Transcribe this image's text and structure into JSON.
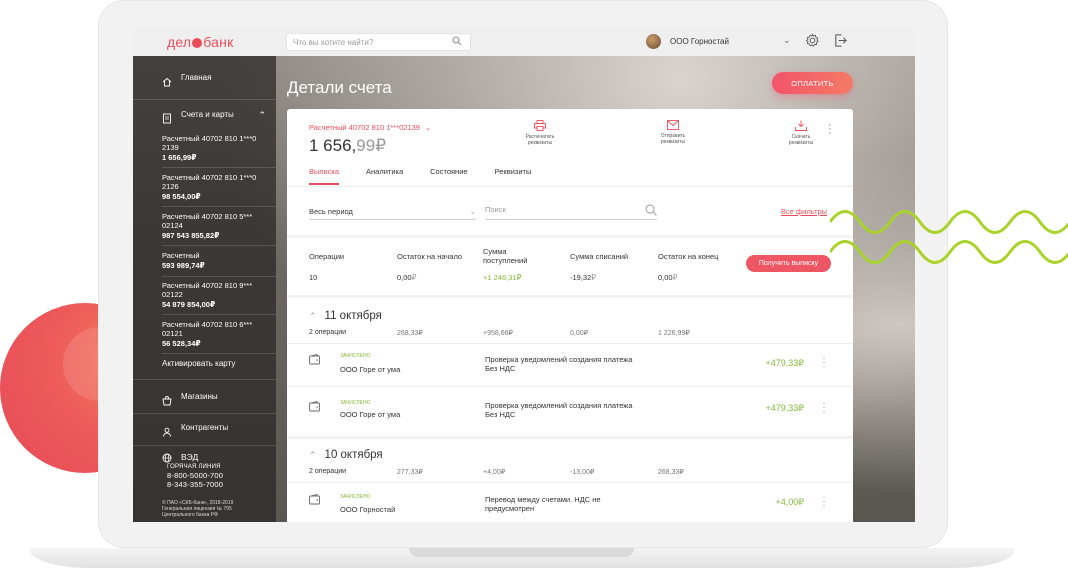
{
  "topbar": {
    "logo_left": "дел",
    "logo_right": "банк",
    "search_placeholder": "Что вы хотите найти?",
    "company": "ООО Горностай"
  },
  "sidebar": {
    "home": "Главная",
    "accounts": "Счета и карты",
    "account_list": [
      {
        "name": "Расчетный 40702 810 1***0 2139",
        "balance": "1 656,99₽"
      },
      {
        "name": "Расчетный 40702 810 1***0 2126",
        "balance": "98 554,00₽"
      },
      {
        "name": "Расчетный 40702 810 5*** 02124",
        "balance": "987 543 855,82₽"
      },
      {
        "name": "Расчетный",
        "balance": "593 989,74₽"
      },
      {
        "name": "Расчетный 40702 810 9*** 02122",
        "balance": "54 879 854,00₽"
      },
      {
        "name": "Расчетный 40702 810 6*** 02121",
        "balance": "56 528,34₽"
      }
    ],
    "activate_card": "Активировать карту",
    "shops": "Магазины",
    "contractors": "Контрагенты",
    "ved": "ВЭД",
    "hotline_label": "ГОРЯЧАЯ ЛИНИЯ",
    "phone1": "8-800-5000-700",
    "phone2": "8-343-355-7000",
    "copyright": "© ПАО «СКБ-банк», 2018-2019",
    "license": "Генеральная лицензия № 705",
    "cb": "Центрального банка РФ"
  },
  "main": {
    "title": "Детали счета",
    "pay_button": "ОПЛАТИТЬ",
    "account_number": "Расчетный 40702 810 1***02139",
    "balance_int": "1 656,",
    "balance_frac": "99",
    "currency": "₽",
    "actions": {
      "print_1": "Распечатать",
      "print_2": "реквизиты",
      "send_1": "Отправить",
      "send_2": "реквизиты",
      "download_1": "Скачать",
      "download_2": "реквизиты"
    },
    "tabs": [
      "Выписка",
      "Аналитика",
      "Состояние",
      "Реквизиты"
    ],
    "period": "Весь период",
    "search_placeholder": "Поиск",
    "all_filters": "Все фильтры",
    "summary_headers": {
      "operations": "Операции",
      "start_balance": "Остаток на начало",
      "income_1": "Сумма",
      "income_2": "поступлений",
      "spend": "Сумма списаний",
      "end_balance": "Остаток на конец"
    },
    "summary_values": {
      "operations": "10",
      "start_int": "0,00",
      "income_int": "+1 246,31",
      "spend_int": "-19,32",
      "end_int": "0,00",
      "rub": "₽"
    },
    "get_statement": "Получить выписку",
    "days": [
      {
        "date": "11 октября",
        "ops": "2 операции",
        "start": "268,33₽",
        "income": "+958,66₽",
        "spend": "0,00₽",
        "end": "1 226,99₽",
        "tx": [
          {
            "status": "ЗАЧИСЛЕНО",
            "counterparty": "ООО Горе от ума",
            "desc_1": "Проверка уведомлений создания платежа",
            "desc_2": "Без НДС",
            "amount": "+479,33₽"
          },
          {
            "status": "ЗАЧИСЛЕНО",
            "counterparty": "ООО Горе от ума",
            "desc_1": "Проверка уведомлений создания платежа",
            "desc_2": "Без НДС",
            "amount": "+479,33₽"
          }
        ]
      },
      {
        "date": "10 октября",
        "ops": "2 операции",
        "start": "277,33₽",
        "income": "+4,00₽",
        "spend": "-13,00₽",
        "end": "268,33₽",
        "tx": [
          {
            "status": "ЗАЧИСЛЕНО",
            "counterparty": "ООО Горностай",
            "desc_1": "Перевод между счетами. НДС не",
            "desc_2": "предусмотрен",
            "amount": "+4,00₽"
          }
        ]
      }
    ]
  },
  "colors": {
    "accent": "#e94d5a",
    "positive": "#86b83a",
    "wave": "#a9d32c"
  }
}
